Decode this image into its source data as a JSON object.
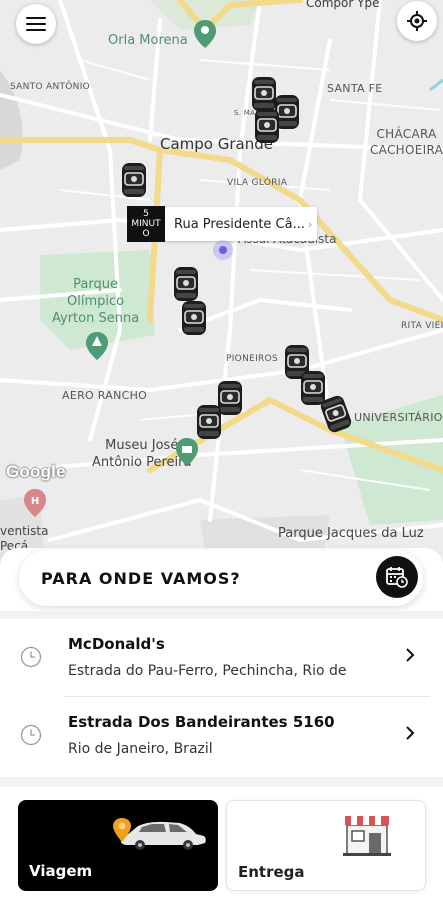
{
  "map": {
    "labels": {
      "compor_ype": "Compor Ype",
      "orla_morena": "Orla Morena",
      "santo_antonio": "SANTO ANTÔNIO",
      "santa_fe": "SANTA FE",
      "campo_grande": "Campo Grande",
      "chacara": "CHÁCARA\nCACHOEIRA",
      "vila_gloria": "VILA GLÓRIA",
      "assai": "Assaí Atacadista",
      "parque_olimpico": "Parque\nOlímpico\nAyrton Senna",
      "rita_vieira": "RITA VIEIR",
      "pioneiros": "PIONEIROS",
      "aero_rancho": "AERO RANCHO",
      "universitario": "UNIVERSITÁRIO",
      "museu": "Museu José\nAntônio Pereira",
      "parque_jacques": "Parque Jacques da Luz",
      "adventista": "ventista\nPeçá",
      "small_street": "S. MARIA"
    },
    "eta_badge": "5\nMINUT\nO",
    "pickup_address": "Rua Presidente Câ...",
    "google_logo": "Google",
    "menu_icon": "hamburger-menu-icon",
    "locate_icon": "my-location-icon",
    "colors": {
      "park": "#cfe8d2",
      "road_major": "#f3d98a",
      "road_minor": "#ffffff",
      "user_dot": "#6a5cf5"
    }
  },
  "sheet": {
    "search_title": "PARA ONDE VAMOS?",
    "schedule_icon": "calendar-clock-icon",
    "recent": [
      {
        "title": "McDonald's",
        "subtitle": "Estrada do Pau-Ferro, Pechincha, Rio de"
      },
      {
        "title": "Estrada Dos Bandeirantes 5160",
        "subtitle": "Rio de Janeiro, Brazil"
      }
    ],
    "services": [
      {
        "label": "Viagem",
        "icon": "car-with-pin-icon",
        "selected": true
      },
      {
        "label": "Entrega",
        "icon": "storefront-icon",
        "selected": false
      }
    ]
  }
}
